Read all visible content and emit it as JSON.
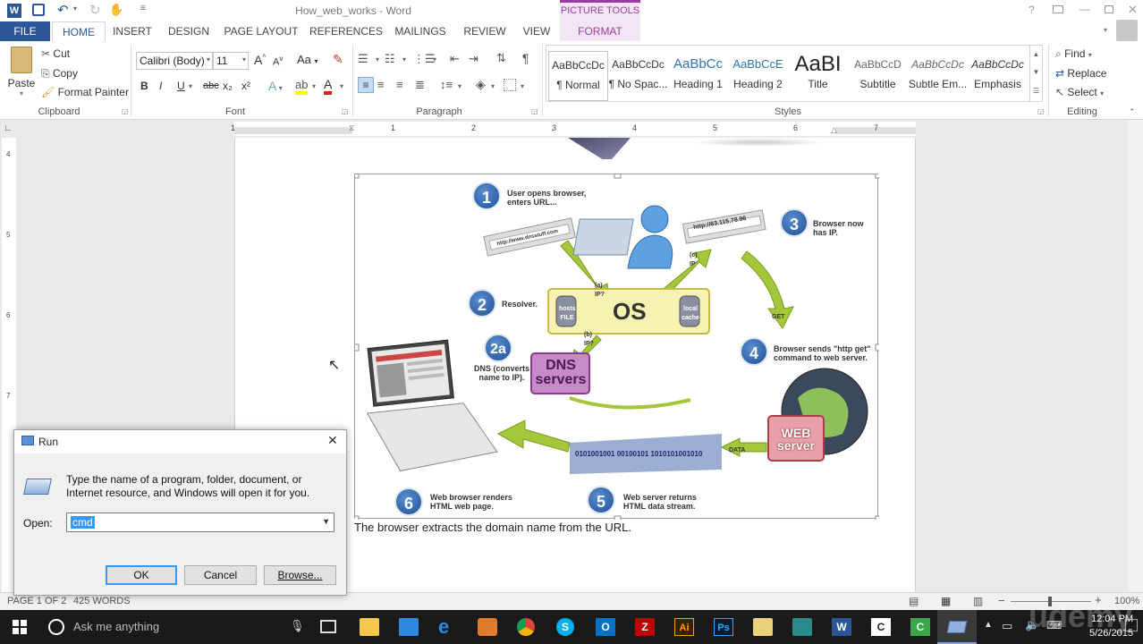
{
  "window": {
    "title": "How_web_works - Word",
    "context_tab_group": "PICTURE TOOLS"
  },
  "tabs": [
    "FILE",
    "HOME",
    "INSERT",
    "DESIGN",
    "PAGE LAYOUT",
    "REFERENCES",
    "MAILINGS",
    "REVIEW",
    "VIEW",
    "FORMAT"
  ],
  "clipboard": {
    "paste": "Paste",
    "cut": "Cut",
    "copy": "Copy",
    "format_painter": "Format Painter",
    "label": "Clipboard"
  },
  "font": {
    "name": "Calibri (Body)",
    "size": "11",
    "label": "Font",
    "grow": "A",
    "shrink": "A",
    "case": "Aa",
    "bold": "B",
    "italic": "I",
    "underline": "U",
    "strike": "abc",
    "sub": "x₂",
    "sup": "x²",
    "effects": "A",
    "color": "A"
  },
  "paragraph": {
    "label": "Paragraph"
  },
  "styles": {
    "label": "Styles",
    "items": [
      {
        "preview": "AaBbCcDc",
        "name": "¶ Normal"
      },
      {
        "preview": "AaBbCcDc",
        "name": "¶ No Spac..."
      },
      {
        "preview": "AaBbCc",
        "name": "Heading 1"
      },
      {
        "preview": "AaBbCcE",
        "name": "Heading 2"
      },
      {
        "preview": "AaBI",
        "name": "Title"
      },
      {
        "preview": "AaBbCcD",
        "name": "Subtitle"
      },
      {
        "preview": "AaBbCcDc",
        "name": "Subtle Em..."
      },
      {
        "preview": "AaBbCcDc",
        "name": "Emphasis"
      }
    ]
  },
  "editing": {
    "find": "Find",
    "replace": "Replace",
    "select": "Select",
    "label": "Editing"
  },
  "ruler": {
    "marks": [
      "1",
      "1",
      "2",
      "3",
      "4",
      "5",
      "6",
      "7"
    ]
  },
  "vruler": {
    "marks": [
      "4",
      "5",
      "6",
      "7"
    ]
  },
  "diagram": {
    "steps": [
      {
        "num": "1",
        "text": "User opens browser, enters URL..."
      },
      {
        "num": "2",
        "text": "Resolver."
      },
      {
        "num": "2a",
        "text": "DNS (converts name to IP)."
      },
      {
        "num": "3",
        "text": "Browser now has IP."
      },
      {
        "num": "4",
        "text": "Browser sends \"http get\" command to web server."
      },
      {
        "num": "5",
        "text": "Web server returns HTML data stream."
      },
      {
        "num": "6",
        "text": "Web browser renders HTML web page."
      }
    ],
    "os": "OS",
    "hosts": "hosts FILE",
    "local_cache": "local cache",
    "dns": "DNS servers",
    "web": "WEB server",
    "url1": "http://www.dnsstuff.com",
    "url2": "http://63.115.78.96",
    "a_ip": "(a) IP?",
    "b_ip": "(b) IP?",
    "c_ip": "(c) IP",
    "get": "GET",
    "data": "DATA",
    "stream": "0101001001 00100101 1010101001010"
  },
  "document": {
    "caption": "The browser extracts the domain name from the URL."
  },
  "status": {
    "page": "PAGE 1 OF 2",
    "words": "425 WORDS",
    "zoom": "100%"
  },
  "run_dialog": {
    "title": "Run",
    "description": "Type the name of a program, folder, document, or Internet resource, and Windows will open it for you.",
    "open_label": "Open:",
    "open_value": "cmd",
    "ok": "OK",
    "cancel": "Cancel",
    "browse": "Browse..."
  },
  "taskbar": {
    "search_placeholder": "Ask me anything",
    "time": "12:04 PM",
    "date": "5/26/2015",
    "watermark": "udemy"
  },
  "colors": {
    "word_blue": "#2b579a",
    "accent_purple": "#9a3da0",
    "selection": "#3399ff",
    "taskbar": "#1a1a1a"
  }
}
